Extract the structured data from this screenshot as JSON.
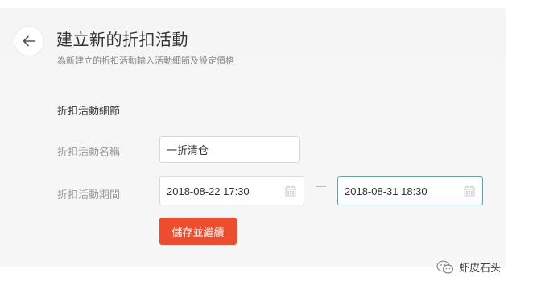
{
  "header": {
    "back_icon": "arrow-left-icon",
    "title": "建立新的折扣活動",
    "subtitle": "為新建立的折扣活動輸入活動細節及設定價格"
  },
  "form": {
    "section_title": "折扣活動細節",
    "name_label": "折扣活動名稱",
    "name_value": "一折清仓",
    "period_label": "折扣活動期間",
    "start_value": "2018-08-22 17:30",
    "end_value": "2018-08-31 18:30",
    "calendar_icon": "calendar-icon",
    "save_label": "儲存並繼續"
  },
  "watermark": {
    "icon": "wechat-icon",
    "text": "虾皮石头"
  },
  "colors": {
    "accent": "#ee4d2d",
    "focus_border": "#3ab7a7"
  }
}
